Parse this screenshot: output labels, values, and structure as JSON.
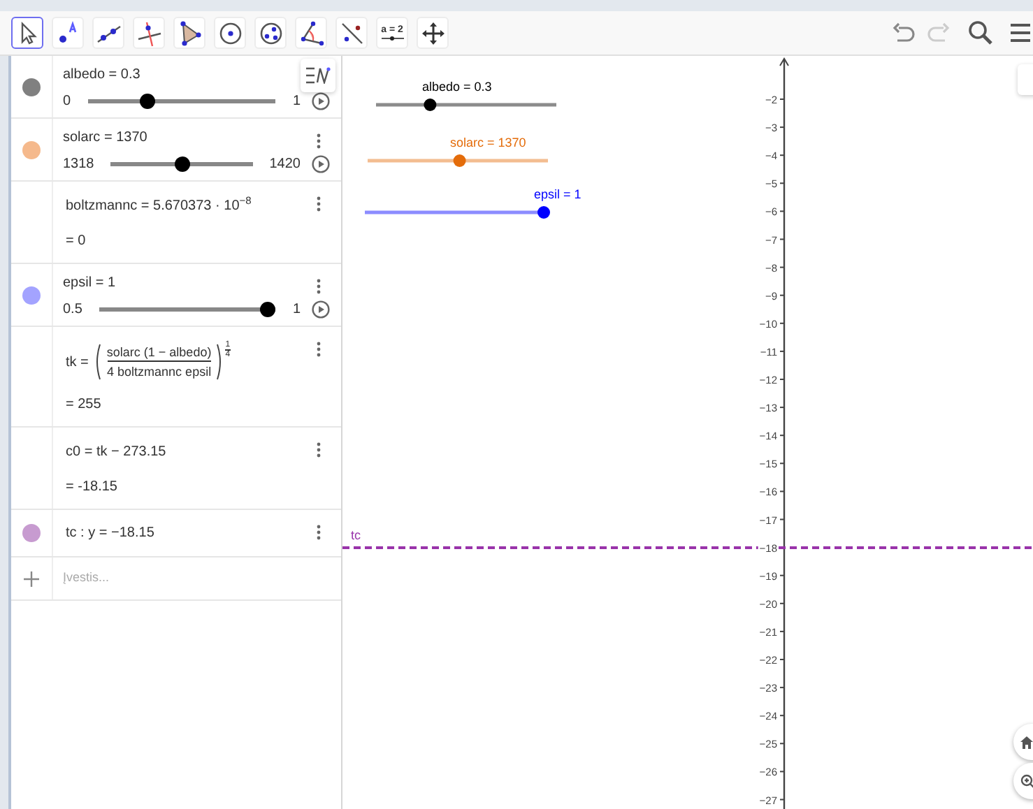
{
  "toolbar": {
    "tools": [
      {
        "kind": "move",
        "selected": true
      },
      {
        "kind": "point",
        "selected": false
      },
      {
        "kind": "line",
        "selected": false
      },
      {
        "kind": "perpendicular",
        "selected": false
      },
      {
        "kind": "polygon",
        "selected": false
      },
      {
        "kind": "circle",
        "selected": false
      },
      {
        "kind": "conic",
        "selected": false
      },
      {
        "kind": "angle",
        "selected": false
      },
      {
        "kind": "reflect",
        "selected": false
      },
      {
        "kind": "slider",
        "selected": false,
        "label": "a = 2"
      },
      {
        "kind": "pan",
        "selected": false
      }
    ]
  },
  "algebra": {
    "items": [
      {
        "kind": "slider",
        "color": "#808080",
        "label": "albedo = 0.3",
        "min": "0",
        "max": "1",
        "level": 0.3,
        "menu": false
      },
      {
        "kind": "slider",
        "color": "#f5b98c",
        "label": "solarc = 1370",
        "min": "1318",
        "max": "1420",
        "level": 0.51,
        "menu": true
      },
      {
        "kind": "expression",
        "label": "boltzmannc = 5.670373 · 10$^{−8}$",
        "result": "= 0",
        "menu": true
      },
      {
        "kind": "slider",
        "color": "#a3a3ff",
        "label": "epsil = 1",
        "min": "0.5",
        "max": "1",
        "level": 1,
        "menu": true
      },
      {
        "kind": "power",
        "lhs": "tk =",
        "numerator": "solarc (1 − albedo)",
        "denominator": "4 boltzmannc epsil",
        "exponent_numerator": "1",
        "exponent_denominator": "4",
        "result": "= 255",
        "menu": true
      },
      {
        "kind": "expression",
        "label": "c0 = tk − 273.15",
        "result": "= -18.15",
        "menu": true
      },
      {
        "kind": "line",
        "color": "#c79bd0",
        "label": "tc : y = −18.15",
        "menu": true
      },
      {
        "kind": "input",
        "placeholder": "Įvestis..."
      }
    ]
  },
  "graphics": {
    "sliders": [
      {
        "label": "albedo = 0.3",
        "color": "#000000",
        "level": 0.3
      },
      {
        "label": "solarc = 1370",
        "color": "#e46c0a",
        "level": 0.51
      },
      {
        "label": "epsil = 1",
        "color": "#0000ff",
        "level": 1
      }
    ],
    "y_axis_labels": [
      "−2",
      "−3",
      "−4",
      "−5",
      "−6",
      "−7",
      "−8",
      "−9",
      "−10",
      "−11",
      "−12",
      "−13",
      "−14",
      "−15",
      "−16",
      "−17",
      "−18",
      "−19",
      "−20",
      "−21",
      "−22",
      "−23",
      "−24",
      "−25",
      "−26",
      "−27"
    ],
    "line": {
      "label": "tc",
      "color": "#9933aa"
    }
  }
}
